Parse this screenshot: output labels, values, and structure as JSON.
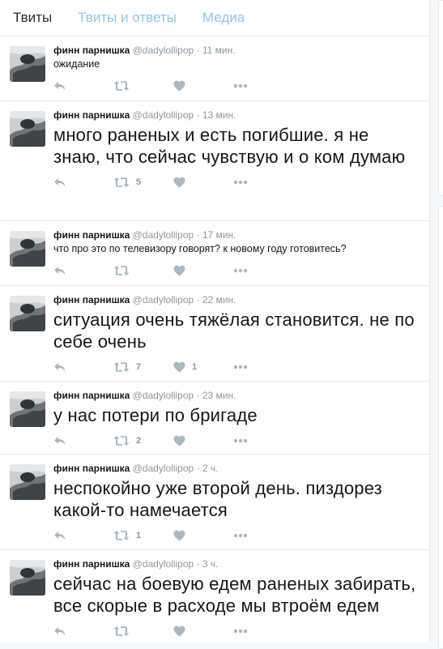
{
  "tabs": [
    {
      "label": "Твиты",
      "active": true
    },
    {
      "label": "Твиты и ответы",
      "active": false
    },
    {
      "label": "Медиа",
      "active": false
    }
  ],
  "colors": {
    "tab_inactive": "#8ec5ec",
    "icon": "#aab8c2",
    "meta": "#8899a6"
  },
  "icons": [
    "reply-icon",
    "retweet-icon",
    "like-icon",
    "more-icon"
  ],
  "tweets": [
    {
      "name": "финн парнишка",
      "handle": "@dadylollipop",
      "sep": "·",
      "time": "11 мин.",
      "text": "ожидание",
      "retweets": "",
      "likes": ""
    },
    {
      "name": "финн парнишка",
      "handle": "@dadylollipop",
      "sep": "·",
      "time": "13 мин.",
      "text": "много раненых и есть погибшие. я не знаю, что сейчас чувствую и о ком думаю",
      "retweets": "5",
      "likes": ""
    },
    {
      "name": "финн парнишка",
      "handle": "@dadylollipop",
      "sep": "·",
      "time": "17 мин.",
      "text": "что про это по телевизору говорят? к новому году готовитесь?",
      "retweets": "",
      "likes": ""
    },
    {
      "name": "финн парнишка",
      "handle": "@dadylollipop",
      "sep": "·",
      "time": "22 мин.",
      "text": "ситуация  очень тяжёлая становится. не по себе очень",
      "retweets": "7",
      "likes": "1"
    },
    {
      "name": "финн парнишка",
      "handle": "@dadylollipop",
      "sep": "·",
      "time": "23 мин.",
      "text": "у нас потери по бригаде",
      "retweets": "2",
      "likes": ""
    },
    {
      "name": "финн парнишка",
      "handle": "@dadylollipop",
      "sep": "·",
      "time": "2 ч.",
      "text": "неспокойно уже второй день. пиздорез какой-то намечается",
      "retweets": "1",
      "likes": ""
    },
    {
      "name": "финн парнишка",
      "handle": "@dadylollipop",
      "sep": "·",
      "time": "3 ч.",
      "text": "сейчас на боевую едем раненых забирать, все скорые в расходе мы втроём едем",
      "retweets": "",
      "likes": ""
    }
  ]
}
